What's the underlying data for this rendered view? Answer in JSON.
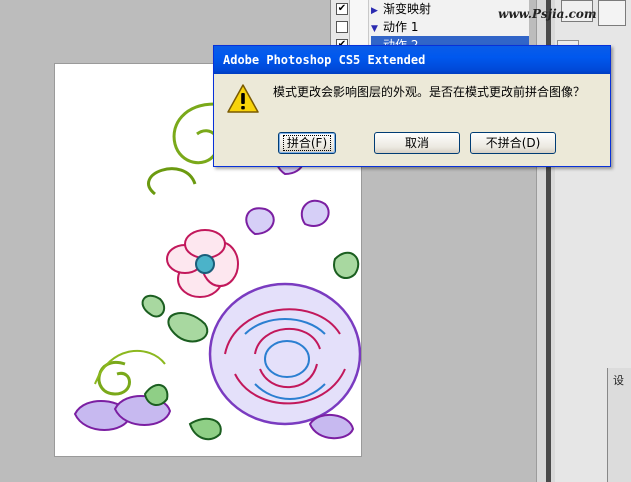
{
  "dialog": {
    "title": "Adobe Photoshop CS5 Extended",
    "icon": "warning-icon",
    "message": "模式更改会影响图层的外观。是否在模式更改前拼合图像？",
    "buttons": {
      "flatten": "拼合(F)",
      "cancel": "取消",
      "dont_flatten": "不拼合(D)"
    }
  },
  "actions_panel": {
    "items": [
      {
        "label": "渐变映射"
      },
      {
        "label": "动作 1"
      },
      {
        "label": "动作 2"
      }
    ]
  },
  "watermark": "www.Psjia.com",
  "right_panel": {
    "bottom_label": "设"
  },
  "colors": {
    "titlebar": "#0054e3",
    "dialog_bg": "#ece9d8",
    "workspace": "#bcbcbc",
    "selection": "#3165c8"
  }
}
